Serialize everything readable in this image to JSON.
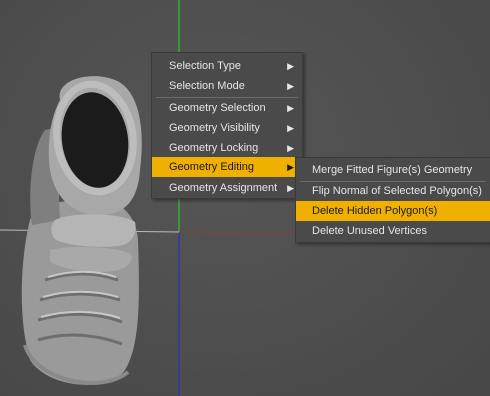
{
  "context_menu": {
    "items": [
      {
        "label": "Selection Type",
        "icon": "triangle-right-icon"
      },
      {
        "label": "Selection Mode",
        "icon": "triangle-right-icon"
      },
      {
        "label": "Geometry Selection",
        "icon": "triangle-right-icon"
      },
      {
        "label": "Geometry Visibility",
        "icon": "triangle-right-icon"
      },
      {
        "label": "Geometry Locking",
        "icon": "triangle-right-icon"
      },
      {
        "label": "Geometry Editing",
        "icon": "triangle-right-icon",
        "active": true
      },
      {
        "label": "Geometry Assignment",
        "icon": "triangle-right-icon"
      }
    ]
  },
  "submenu": {
    "items": [
      {
        "label": "Merge Fitted Figure(s) Geometry"
      },
      {
        "label": "Flip Normal of Selected Polygon(s)"
      },
      {
        "label": "Delete Hidden Polygon(s)",
        "active": true
      },
      {
        "label": "Delete Unused Vertices"
      }
    ]
  },
  "arrow_glyph": "▶",
  "colors": {
    "highlight": "#f0b000",
    "axis_y_pos": "#22cc22",
    "axis_y_neg": "#2233cc",
    "axis_x_neg": "#cc2222",
    "axis_x_pos": "#bbbbbb"
  }
}
